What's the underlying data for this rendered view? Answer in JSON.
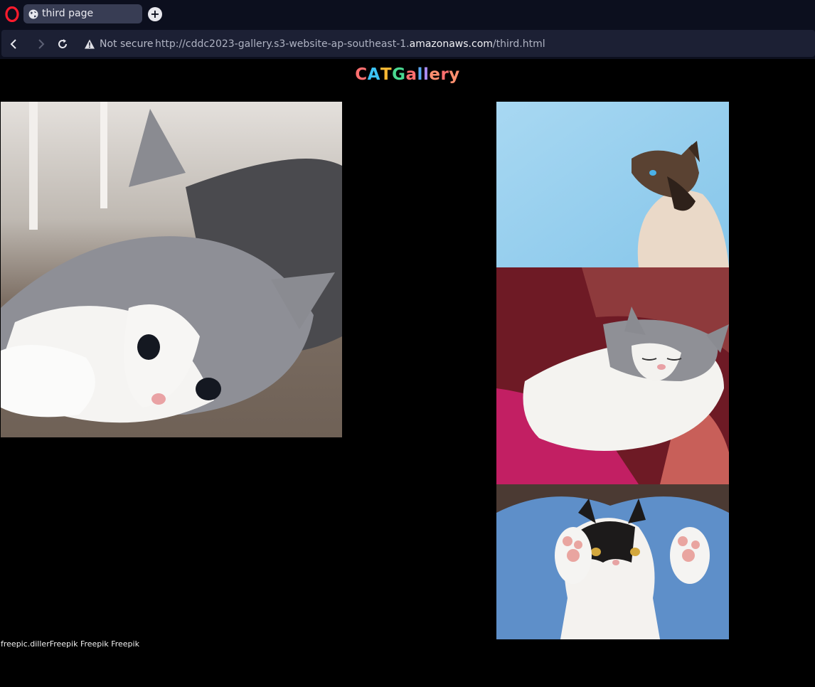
{
  "browser": {
    "tab_title": "third page",
    "new_tab_label": "+",
    "security_label": "Not secure",
    "url_prefix": "http://cddc2023-gallery.s3-website-ap-southeast-1.",
    "url_host": "amazonaws.com",
    "url_path": "/third.html"
  },
  "page": {
    "title_letters": [
      {
        "char": "C",
        "color": "#ff6f6f"
      },
      {
        "char": "A",
        "color": "#3cc3f5"
      },
      {
        "char": "T",
        "color": "#f7b733"
      },
      {
        "char": "G",
        "color": "#4ad991"
      },
      {
        "char": "a",
        "color": "#ff6f6f"
      },
      {
        "char": "l",
        "color": "#5aa8f0"
      },
      {
        "char": "l",
        "color": "#a98bf0"
      },
      {
        "char": "e",
        "color": "#ff8f6f"
      },
      {
        "char": "r",
        "color": "#ff6f6f"
      },
      {
        "char": "y",
        "color": "#ff8f6f"
      }
    ],
    "photos": [
      {
        "alt": "grey and white kitten lying down"
      },
      {
        "alt": "siamese cat looking up against blue sky"
      },
      {
        "alt": "grey and white kitten sleeping on pink blanket"
      },
      {
        "alt": "black and white kitten raising paws"
      }
    ],
    "credits": "freepic.dillerFreepik Freepik Freepik"
  },
  "colors": {
    "chrome_bg": "#0c0f1e",
    "address_bg": "#1c2034",
    "tab_bg": "#383d54",
    "opera_red": "#ff1b2d",
    "page_bg": "#000000"
  }
}
